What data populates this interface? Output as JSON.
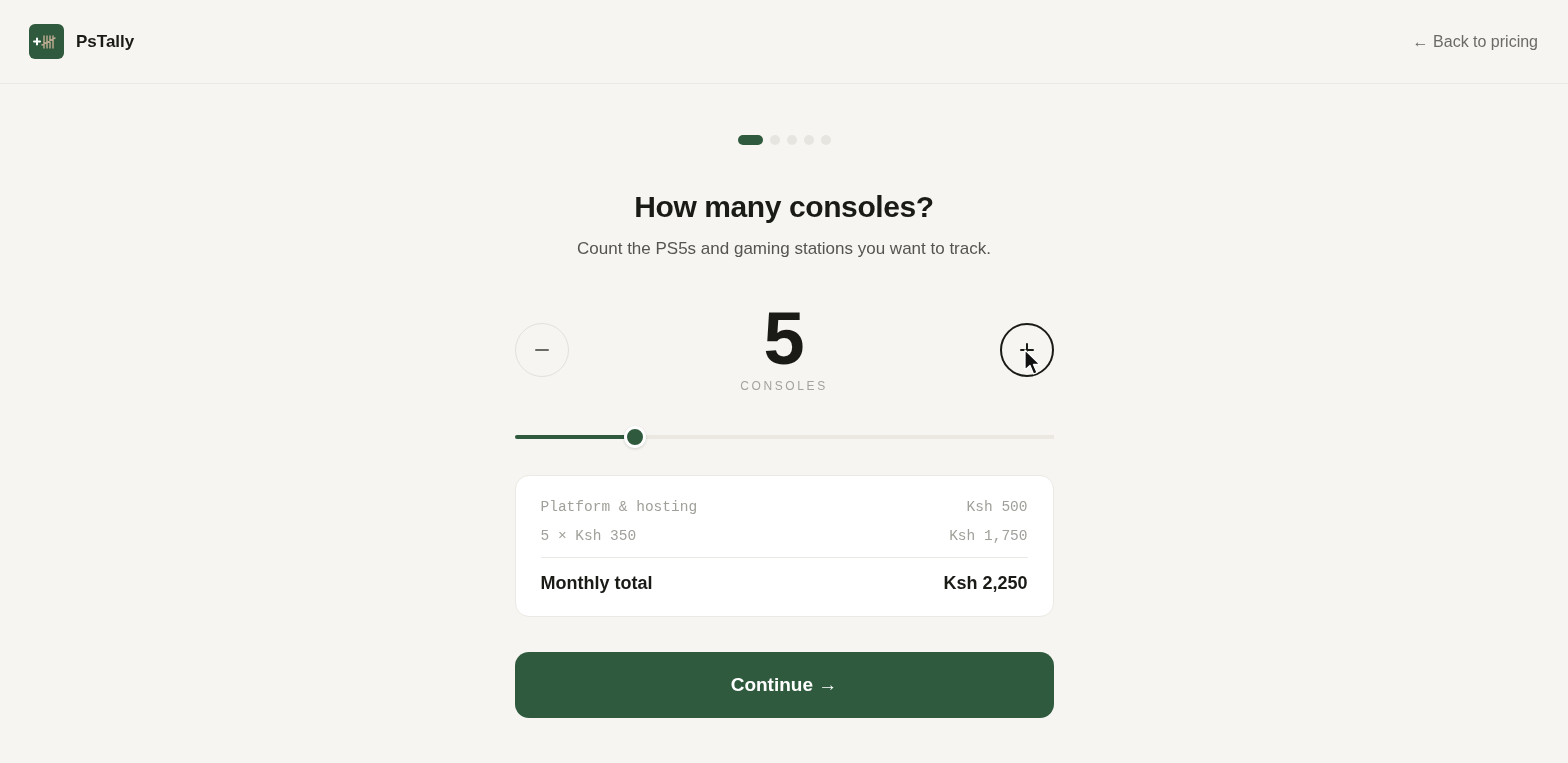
{
  "header": {
    "brand": "PsTally",
    "back_link": "← Back to pricing"
  },
  "steps": [
    {
      "selected": true
    },
    {
      "selected": false
    },
    {
      "selected": false
    },
    {
      "selected": false
    },
    {
      "selected": false
    }
  ],
  "title": "How many consoles?",
  "subtitle": "Count the PS5s and gaming stations you want to track.",
  "counter": {
    "value": "5",
    "unit": "CONSOLES",
    "decrement": {
      "hovered": false
    },
    "increment": {
      "hovered": true
    }
  },
  "slider": {
    "level": 0.223
  },
  "breakdown": {
    "lines": [
      {
        "label": "Platform & hosting",
        "amount": "Ksh 500"
      },
      {
        "label": "5 × Ksh 350",
        "amount": "Ksh 1,750"
      }
    ],
    "total": {
      "label": "Monthly total",
      "amount": "Ksh 2,250"
    }
  },
  "primary_button": "Continue →"
}
